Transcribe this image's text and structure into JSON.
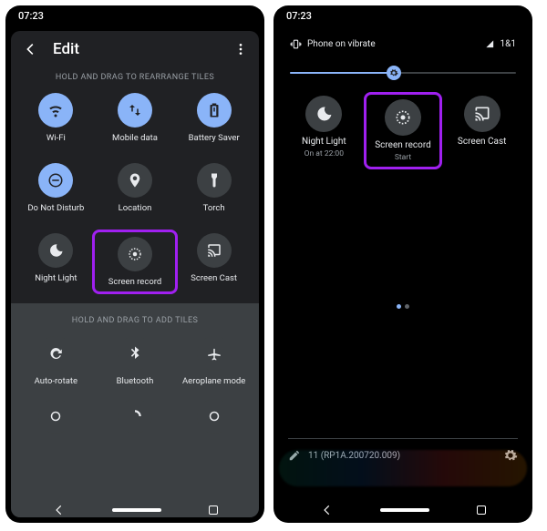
{
  "left": {
    "clock": "07:23",
    "title": "Edit",
    "hint_active": "HOLD AND DRAG TO REARRANGE TILES",
    "hint_add": "HOLD AND DRAG TO ADD TILES",
    "tiles_active": [
      {
        "label": "Wi-Fi",
        "icon": "wifi",
        "active": true
      },
      {
        "label": "Mobile data",
        "icon": "swap",
        "active": true
      },
      {
        "label": "Battery Saver",
        "icon": "battery",
        "active": true
      },
      {
        "label": "Do Not Disturb",
        "icon": "dnd",
        "active": true
      },
      {
        "label": "Location",
        "icon": "location",
        "active": false
      },
      {
        "label": "Torch",
        "icon": "torch",
        "active": false
      },
      {
        "label": "Night Light",
        "icon": "moon",
        "active": false
      },
      {
        "label": "Screen record",
        "icon": "record",
        "active": false,
        "highlight": true
      },
      {
        "label": "Screen Cast",
        "icon": "cast",
        "active": false
      }
    ],
    "tiles_add": [
      {
        "label": "Auto-rotate",
        "icon": "rotate"
      },
      {
        "label": "Bluetooth",
        "icon": "bluetooth"
      },
      {
        "label": "Aeroplane mode",
        "icon": "airplane"
      }
    ]
  },
  "right": {
    "clock": "07:23",
    "vibrate_text": "Phone on vibrate",
    "network": "1&1",
    "brightness_pct": 46,
    "tiles": [
      {
        "label": "Night Light",
        "sub": "On at 22:00",
        "icon": "moon"
      },
      {
        "label": "Screen record",
        "sub": "Start",
        "icon": "record",
        "highlight": true
      },
      {
        "label": "Screen Cast",
        "sub": "",
        "icon": "cast"
      }
    ],
    "build": "11 (RP1A.200720.009)"
  }
}
